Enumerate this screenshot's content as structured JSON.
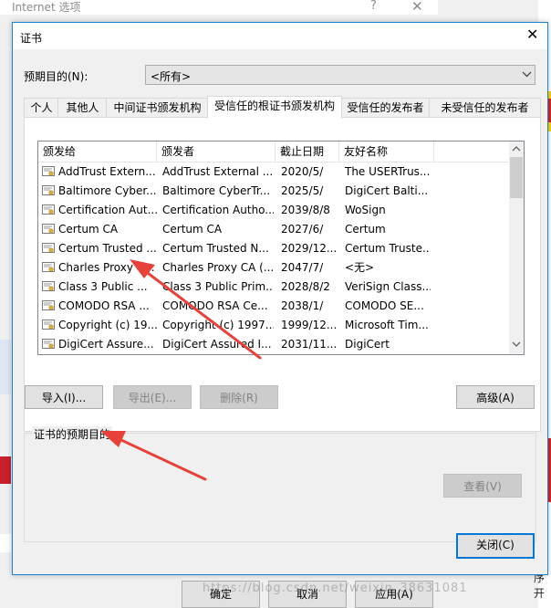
{
  "background_window": {
    "title": "Internet 选项",
    "help_glyph": "?",
    "close_glyph": "✕",
    "buttons": {
      "ok": "确定",
      "cancel": "取消",
      "apply": "应用(A)"
    },
    "corner_text": "序开",
    "watermark": "https://blog.csdn.net/weixin_38631081"
  },
  "dialog": {
    "title": "证书",
    "close_glyph": "✕",
    "purpose_label": "预期目的(N):",
    "purpose_value": "<所有>",
    "tabs": [
      "个人",
      "其他人",
      "中间证书颁发机构",
      "受信任的根证书颁发机构",
      "受信任的发布者",
      "未受信任的发布者"
    ],
    "active_tab_index": 3,
    "list": {
      "columns": [
        "颁发给",
        "颁发者",
        "截止日期",
        "友好名称"
      ],
      "rows": [
        [
          "AddTrust Extern...",
          "AddTrust External ...",
          "2020/5/",
          "The USERTrus..."
        ],
        [
          "Baltimore Cyber...",
          "Baltimore CyberTr...",
          "2025/5/",
          "DigiCert Balti..."
        ],
        [
          "Certification Aut...",
          "Certification Autho...",
          "2039/8/8",
          "WoSign"
        ],
        [
          "Certum CA",
          "Certum CA",
          "2027/6/",
          "Certum"
        ],
        [
          "Certum Trusted ...",
          "Certum Trusted N...",
          "2029/12...",
          "Certum Truste..."
        ],
        [
          "Charles Proxy C...",
          "Charles Proxy CA (...",
          "2047/7/",
          "<无>"
        ],
        [
          "Class 3 Public ...",
          "Class 3 Public Prim...",
          "2028/8/2",
          "VeriSign Class..."
        ],
        [
          "COMODO RSA ...",
          "COMODO RSA Ce...",
          "2038/1/",
          "COMODO SE..."
        ],
        [
          "Copyright (c) 19...",
          "Copyright (c) 1997...",
          "1999/12...",
          "Microsoft Tim..."
        ],
        [
          "DigiCert Assure...",
          "DigiCert Assured I...",
          "2031/11...",
          "DigiCert"
        ]
      ]
    },
    "buttons": {
      "import": "导入(I)...",
      "export": "导出(E)...",
      "remove": "删除(R)",
      "advanced": "高级(A)",
      "view": "查看(V)",
      "close": "关闭(C)"
    },
    "purposes_group_label": "证书的预期目的"
  },
  "colors": {
    "accent_blue": "#0078d7",
    "annotation_arrow": "#e8413a",
    "dialog_border": "#1883d7"
  },
  "icons": [
    "cert-icon",
    "close-icon",
    "help-icon",
    "dropdown-chevron-icon",
    "scroll-up-icon",
    "scroll-down-icon"
  ]
}
